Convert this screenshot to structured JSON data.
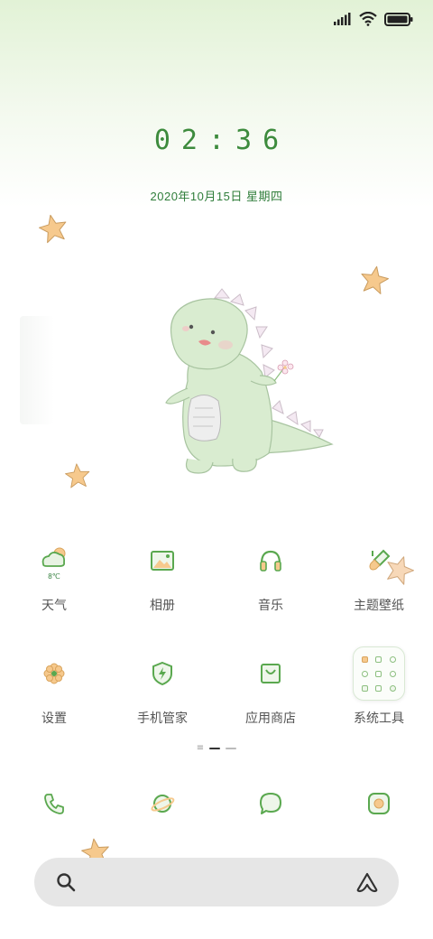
{
  "status_bar": {
    "icons": [
      "signal-icon",
      "wifi-icon",
      "battery-icon"
    ]
  },
  "lockscreen": {
    "time": "02:36",
    "date": "2020年10月15日  星期四"
  },
  "apps": [
    {
      "label": "天气",
      "icon": "weather-icon",
      "temp": "8℃"
    },
    {
      "label": "相册",
      "icon": "gallery-icon"
    },
    {
      "label": "音乐",
      "icon": "headphones-icon"
    },
    {
      "label": "主题壁纸",
      "icon": "paint-brush-icon"
    },
    {
      "label": "设置",
      "icon": "gear-flower-icon"
    },
    {
      "label": "手机管家",
      "icon": "shield-bolt-icon"
    },
    {
      "label": "应用商店",
      "icon": "shopping-bag-icon"
    },
    {
      "label": "系统工具",
      "icon": "folder-icon"
    }
  ],
  "page_indicator": {
    "pages": 3,
    "current": 1
  },
  "dock": [
    {
      "icon": "phone-icon"
    },
    {
      "icon": "browser-planet-icon"
    },
    {
      "icon": "message-icon"
    },
    {
      "icon": "camera-icon"
    }
  ],
  "search": {
    "left_icon": "search-icon",
    "right_icon": "assistant-icon"
  },
  "colors": {
    "accent": "#3d8b3d",
    "icon_green": "#5aa84f",
    "star": "#f6c98d",
    "dino": "#d9ecd0"
  }
}
